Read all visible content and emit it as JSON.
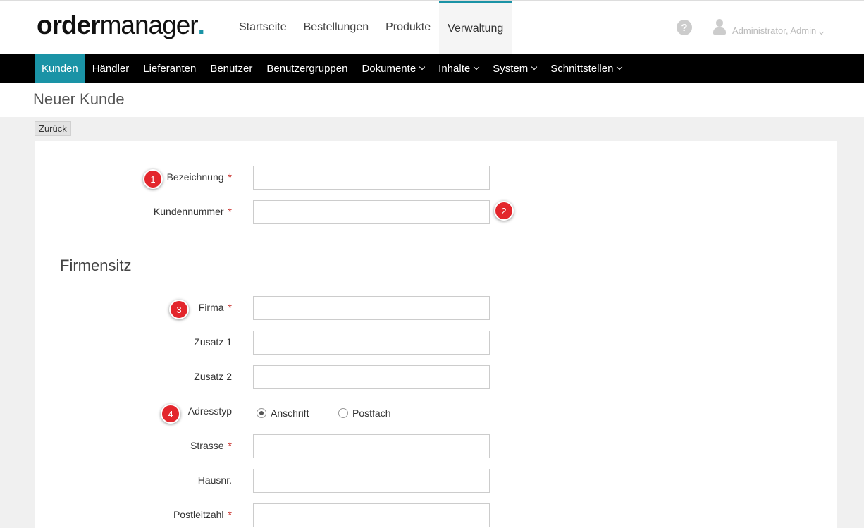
{
  "brand": {
    "bold": "order",
    "rest": "manager",
    "dot": "."
  },
  "topnav": [
    {
      "label": "Startseite"
    },
    {
      "label": "Bestellungen"
    },
    {
      "label": "Produkte"
    },
    {
      "label": "Verwaltung",
      "active": true
    }
  ],
  "header": {
    "help_icon": "question-circle-icon",
    "help_glyph": "?",
    "user_icon": "user-icon",
    "user_name": "Administrator, Admin"
  },
  "mainnav": [
    {
      "label": "Kunden",
      "active": true
    },
    {
      "label": "Händler"
    },
    {
      "label": "Lieferanten"
    },
    {
      "label": "Benutzer"
    },
    {
      "label": "Benutzergruppen"
    },
    {
      "label": "Dokumente",
      "dropdown": true
    },
    {
      "label": "Inhalte",
      "dropdown": true
    },
    {
      "label": "System",
      "dropdown": true
    },
    {
      "label": "Schnittstellen",
      "dropdown": true
    }
  ],
  "page": {
    "title": "Neuer Kunde",
    "back_label": "Zurück"
  },
  "form": {
    "required_mark": "*",
    "bezeichnung": {
      "label": "Bezeichnung",
      "required": true,
      "value": ""
    },
    "kundennummer": {
      "label": "Kundennummer",
      "required": true,
      "value": ""
    },
    "section_title": "Firmensitz",
    "firma": {
      "label": "Firma",
      "required": true,
      "value": ""
    },
    "zusatz1": {
      "label": "Zusatz 1",
      "required": false,
      "value": ""
    },
    "zusatz2": {
      "label": "Zusatz 2",
      "required": false,
      "value": ""
    },
    "adresstyp": {
      "label": "Adresstyp",
      "options": [
        "Anschrift",
        "Postfach"
      ],
      "selected": "Anschrift"
    },
    "strasse": {
      "label": "Strasse",
      "required": true,
      "value": ""
    },
    "hausnr": {
      "label": "Hausnr.",
      "required": false,
      "value": ""
    },
    "postleitzahl": {
      "label": "Postleitzahl",
      "required": true,
      "value": ""
    }
  },
  "markers": [
    "1",
    "2",
    "3",
    "4"
  ],
  "colors": {
    "accent": "#1a93a6",
    "nav_bg": "#000000",
    "marker": "#e3262c",
    "required": "#c9302c"
  }
}
